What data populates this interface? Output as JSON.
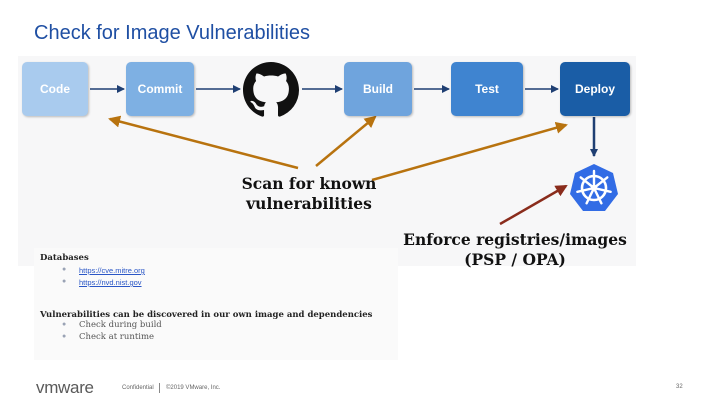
{
  "slide": {
    "title": "Check for Image Vulnerabilities",
    "pipeline": [
      {
        "label": "Code",
        "color": "#a9cbee"
      },
      {
        "label": "Commit",
        "color": "#7eb0e3"
      },
      {
        "label": "Build",
        "color": "#6fa4dd"
      },
      {
        "label": "Test",
        "color": "#3f84d0"
      },
      {
        "label": "Deploy",
        "color": "#1a5da6"
      }
    ],
    "icons": {
      "git": "github-octocat-icon",
      "deploy_target": "kubernetes-helm-icon"
    },
    "scan_callout": [
      "Scan for known",
      "vulnerabilities"
    ],
    "enforce_callout": [
      "Enforce registries/images",
      "(PSP / OPA)"
    ],
    "databases": {
      "heading": "Databases",
      "links": [
        "https://cve.mitre.org",
        "https://nvd.nist.gov"
      ]
    },
    "vulnerabilities": {
      "heading": "Vulnerabilities can be discovered in our own image and dependencies",
      "items": [
        "Check during build",
        "Check at runtime"
      ]
    },
    "colors": {
      "title": "#1f4fa3",
      "arrow_flow": "#1f3f73",
      "arrow_callout": "#b8730f",
      "arrow_enforce": "#8a2c1c",
      "k8s": "#326ce5"
    }
  },
  "footer": {
    "logo": "vmware",
    "confidential": "Confidential",
    "copyright": "©2019 VMware, Inc.",
    "page": "32"
  }
}
